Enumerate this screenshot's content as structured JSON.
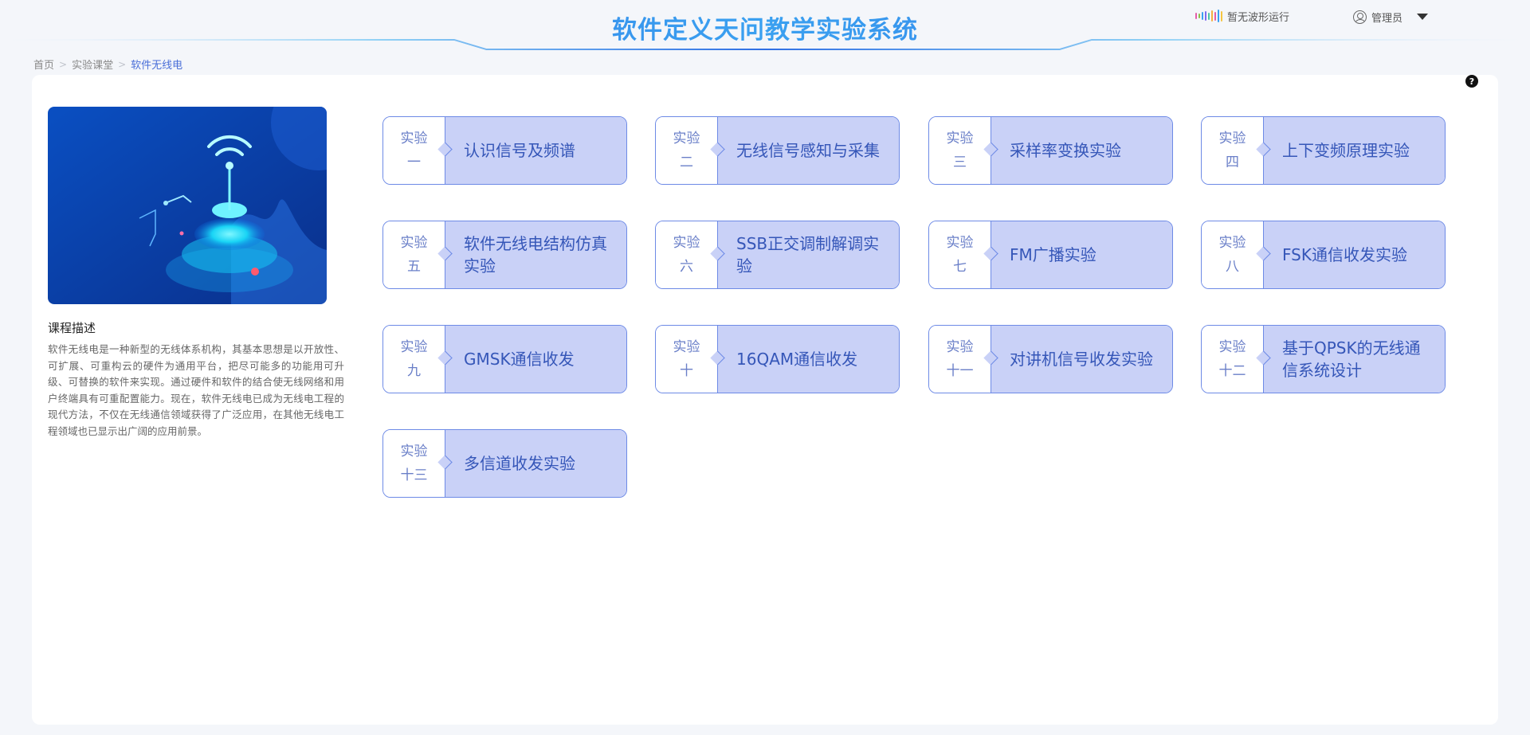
{
  "header": {
    "title": "软件定义天问教学实验系统",
    "wave_status": "暂无波形运行",
    "user_name": "管理员",
    "bar_colors": [
      "#e55ca9",
      "#8bc34a",
      "#3aa0f0",
      "#7c6cf0",
      "#4cc6a8",
      "#f5b041",
      "#e55ca9",
      "#3aa0f0",
      "#f5c542"
    ]
  },
  "breadcrumb": {
    "items": [
      "首页",
      "实验课堂",
      "软件无线电"
    ]
  },
  "help": {
    "icon": "question-icon",
    "glyph": "?"
  },
  "course": {
    "desc_title": "课程描述",
    "description": "软件无线电是一种新型的无线体系机构，其基本思想是以开放性、可扩展、可重构云的硬件为通用平台，把尽可能多的功能用可升级、可替换的软件来实现。通过硬件和软件的结合使无线网络和用户终端具有可重配置能力。现在，软件无线电已成为无线电工程的现代方法，不仅在无线通信领域获得了广泛应用，在其他无线电工程领域也已显示出广阔的应用前景。"
  },
  "experiments": [
    {
      "label1": "实验",
      "label2": "一",
      "name": "认识信号及频谱"
    },
    {
      "label1": "实验",
      "label2": "二",
      "name": "无线信号感知与采集"
    },
    {
      "label1": "实验",
      "label2": "三",
      "name": "采样率变换实验"
    },
    {
      "label1": "实验",
      "label2": "四",
      "name": "上下变频原理实验"
    },
    {
      "label1": "实验",
      "label2": "五",
      "name": "软件无线电结构仿真实验"
    },
    {
      "label1": "实验",
      "label2": "六",
      "name": "SSB正交调制解调实验"
    },
    {
      "label1": "实验",
      "label2": "七",
      "name": "FM广播实验"
    },
    {
      "label1": "实验",
      "label2": "八",
      "name": "FSK通信收发实验"
    },
    {
      "label1": "实验",
      "label2": "九",
      "name": "GMSK通信收发"
    },
    {
      "label1": "实验",
      "label2": "十",
      "name": "16QAM通信收发"
    },
    {
      "label1": "实验",
      "label2": "十一",
      "name": "对讲机信号收发实验"
    },
    {
      "label1": "实验",
      "label2": "十二",
      "name": "基于QPSK的无线通信系统设计"
    },
    {
      "label1": "实验",
      "label2": "十三",
      "name": "多信道收发实验"
    }
  ]
}
